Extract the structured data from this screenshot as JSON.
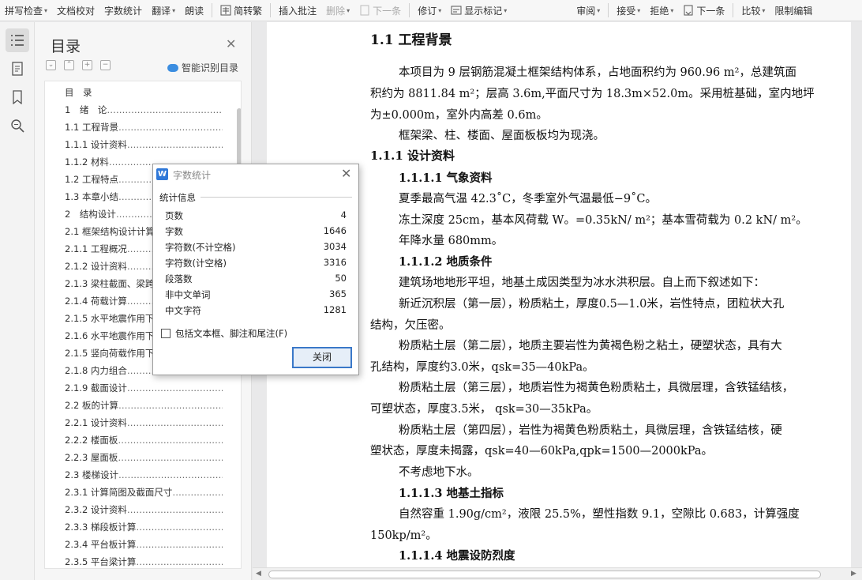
{
  "toolbar": {
    "items": [
      {
        "label": "拼写检查",
        "arrow": "▾"
      },
      {
        "label": "文档校对"
      },
      {
        "label": "字数统计"
      },
      {
        "label": "翻译",
        "arrow": "▾"
      },
      {
        "label": "朗读"
      },
      {
        "label": "简转繁"
      },
      {
        "label": "插入批注"
      },
      {
        "label": "删除",
        "arrow": "▾"
      },
      {
        "label": "下一条"
      },
      {
        "label": "修订",
        "arrow": "▾"
      },
      {
        "label": "显示标记",
        "arrow": "▾"
      },
      {
        "label": "审阅",
        "arrow": "▾"
      },
      {
        "label": "接受",
        "arrow": "▾"
      },
      {
        "label": "拒绝",
        "arrow": "▾"
      },
      {
        "label": "下一条"
      },
      {
        "label": "比较",
        "arrow": "▾"
      },
      {
        "label": "限制编辑"
      }
    ]
  },
  "toc": {
    "title": "目录",
    "smart_label": "智能识别目录",
    "items": [
      "目　录",
      "1　绪　论",
      "1.1 工程背景",
      "1.1.1 设计资料",
      "1.1.2 材料",
      "1.2 工程特点",
      "1.3 本章小结",
      "2　结构设计",
      "2.1 框架结构设计计算",
      "2.1.1 工程概况",
      "2.1.2 设计资料",
      "2.1.3 梁柱截面、梁跨",
      "2.1.4 荷载计算",
      "2.1.5 水平地震作用下",
      "2.1.6 水平地震作用下",
      "2.1.5 竖向荷载作用下",
      "2.1.8 内力组合",
      "2.1.9 截面设计",
      "2.2 板的计算",
      "2.2.1 设计资料",
      "2.2.2 楼面板",
      "2.2.3 屋面板",
      "2.3 楼梯设计",
      "2.3.1 计算简图及截面尺寸",
      "2.3.2 设计资料",
      "2.3.3 梯段板计算",
      "2.3.4 平台板计算",
      "2.3.5 平台梁计算"
    ]
  },
  "dialog": {
    "title": "字数统计",
    "section": "统计信息",
    "stats": [
      {
        "label": "页数",
        "value": "4"
      },
      {
        "label": "字数",
        "value": "1646"
      },
      {
        "label": "字符数(不计空格)",
        "value": "3034"
      },
      {
        "label": "字符数(计空格)",
        "value": "3316"
      },
      {
        "label": "段落数",
        "value": "50"
      },
      {
        "label": "非中文单词",
        "value": "365"
      },
      {
        "label": "中文字符",
        "value": "1281"
      }
    ],
    "checkbox_label": "包括文本框、脚注和尾注(F)",
    "close_button": "关闭"
  },
  "document": {
    "lines": [
      {
        "cls": "h1",
        "text": "1.1  工程背景"
      },
      {
        "cls": "",
        "text": "本项目为 9 层钢筋混凝土框架结构体系，占地面积约为 960.96 m²，总建筑面"
      },
      {
        "cls": "",
        "text": "积约为  8811.84 m²；层高 3.6m,平面尺寸为 18.3m×52.0m。采用桩基础，室内地坪"
      },
      {
        "cls": "",
        "text": "为±0.000m，室外内高差 0.6m。"
      },
      {
        "cls": "",
        "text": "框架梁、柱、楼面、屋面板板均为现浇。"
      },
      {
        "cls": "h2",
        "text": "1.1.1  设计资料"
      },
      {
        "cls": "h3",
        "text": "1.1.1.1  气象资料"
      },
      {
        "cls": "",
        "text": "夏季最高气温 42.3˚C，冬季室外气温最低−9˚C。"
      },
      {
        "cls": "",
        "text": "冻土深度 25cm，基本风荷载 W。=0.35kN/ m²；基本雪荷载为 0.2 kN/ m²。"
      },
      {
        "cls": "",
        "text": "年降水量 680mm。"
      },
      {
        "cls": "h3",
        "text": "1.1.1.2  地质条件"
      },
      {
        "cls": "",
        "text": "建筑场地地形平坦，地基土成因类型为冰水洪积层。自上而下叙述如下："
      },
      {
        "cls": "",
        "text": "新近沉积层（第一层），粉质粘土，厚度0.5—1.0米，岩性特点，团粒状大孔"
      },
      {
        "cls": "",
        "text": "结构，欠压密。"
      },
      {
        "cls": "",
        "text": "粉质粘土层（第二层），地质主要岩性为黄褐色粉之粘土，硬塑状态，具有大"
      },
      {
        "cls": "",
        "text": "孔结构，厚度约3.0米，qsk=35—40kPa。"
      },
      {
        "cls": "",
        "text": "粉质粘土层（第三层），地质岩性为褐黄色粉质粘土，具微层理，含铁锰结核，"
      },
      {
        "cls": "",
        "text": "可塑状态，厚度3.5米，   qsk=30—35kPa。"
      },
      {
        "cls": "",
        "text": "粉质粘土层（第四层），岩性为褐黄色粉质粘土，具微层理，含铁锰结核，硬"
      },
      {
        "cls": "",
        "text": "塑状态，厚度未揭露，qsk=40—60kPa,qpk=1500—2000kPa。"
      },
      {
        "cls": "",
        "text": "不考虑地下水。"
      },
      {
        "cls": "h3",
        "text": "1.1.1.3  地基土指标"
      },
      {
        "cls": "",
        "text": "自然容重 1.90g/cm²，液限 25.5%，塑性指数 9.1，空隙比 0.683，计算强度"
      },
      {
        "cls": "",
        "text": "150kp/m²。"
      },
      {
        "cls": "h3",
        "text": "1.1.1.4  地震设防烈度"
      }
    ]
  }
}
